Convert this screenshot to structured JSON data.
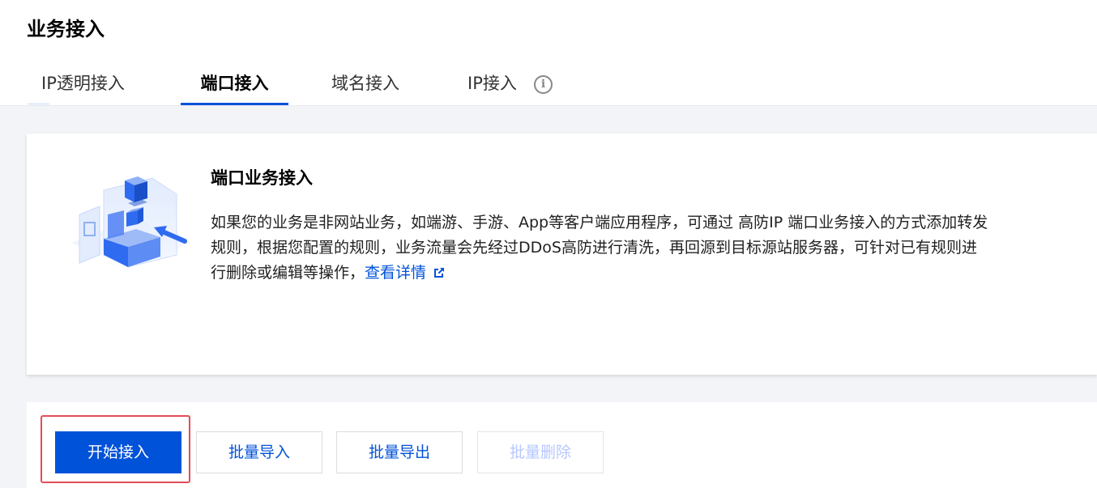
{
  "page": {
    "title": "业务接入"
  },
  "tabs": [
    {
      "label": "IP透明接入",
      "active": false
    },
    {
      "label": "端口接入",
      "active": true
    },
    {
      "label": "域名接入",
      "active": false
    },
    {
      "label": "IP接入",
      "active": false,
      "icon": "info-icon"
    }
  ],
  "intro_card": {
    "title": "端口业务接入",
    "description_line1": "如果您的业务是非网站业务，如端游、手游、App等客户端应用程序，可通过 高防IP 端口业务接入的方式添加转发",
    "description_line2": "规则，根据您配置的规则，业务流量会先经过DDoS高防进行清洗，再回源到目标源站服务器，可针对已有规则进",
    "description_line3": "行删除或编辑等操作，",
    "link_label": "查看详情",
    "link_icon": "external-link-icon",
    "illustration_icon": "port-access-illustration"
  },
  "toolbar": {
    "start_label": "开始接入",
    "import_label": "批量导入",
    "export_label": "批量导出",
    "delete_label": "批量删除"
  },
  "colors": {
    "brand": "#0052d9",
    "highlight": "#e34d59",
    "disabled_text": "#b5c7ff"
  }
}
